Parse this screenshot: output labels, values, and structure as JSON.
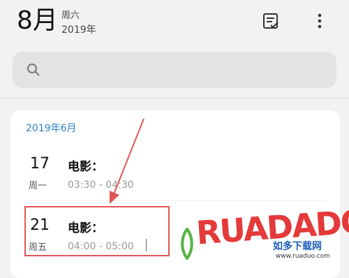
{
  "header": {
    "month": "8月",
    "weekday": "周六",
    "year": "2019年"
  },
  "search": {
    "placeholder": ""
  },
  "agenda": {
    "month_label": "2019年6月",
    "events": [
      {
        "day": "17",
        "weekday": "周一",
        "title": "电影：",
        "time": "03:30 - 04:30"
      },
      {
        "day": "21",
        "weekday": "周五",
        "title": "电影：",
        "time": "04:00 - 05:00"
      }
    ]
  },
  "watermark": {
    "logo": "RUADADO",
    "name": "如多下载网",
    "url": "www.ruaduo.com"
  },
  "colors": {
    "accent": "#2b82c9",
    "highlight": "#e05555"
  }
}
